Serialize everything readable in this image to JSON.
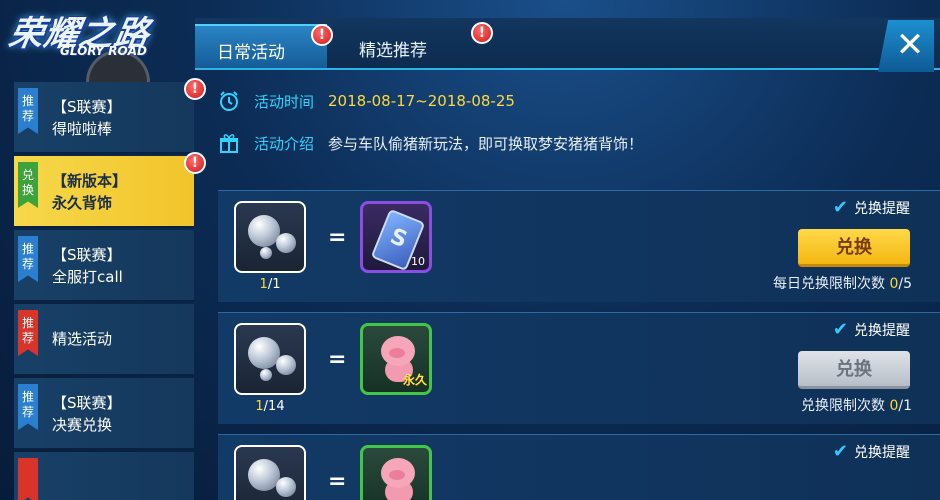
{
  "logo": {
    "title": "荣耀之路",
    "subtitle": "GLORY ROAD"
  },
  "tabs": [
    {
      "label": "日常活动",
      "active": true
    },
    {
      "label": "精选推荐",
      "active": false
    }
  ],
  "alert_symbol": "!",
  "close_symbol": "✕",
  "sidebar": {
    "items": [
      {
        "tag": "推荐",
        "tag_color": "#2a7fd0",
        "line1": "【S联赛】",
        "line2": "得啦啦棒",
        "alert": true,
        "active": false
      },
      {
        "tag": "兑换",
        "tag_color": "#3da33a",
        "line1": "【新版本】",
        "line2": "永久背饰",
        "alert": true,
        "active": true
      },
      {
        "tag": "推荐",
        "tag_color": "#2a7fd0",
        "line1": "【S联赛】",
        "line2": "全服打call",
        "alert": false,
        "active": false
      },
      {
        "tag": "推荐",
        "tag_color": "#d8342a",
        "line1": "精选活动",
        "line2": "",
        "alert": false,
        "active": false
      },
      {
        "tag": "推荐",
        "tag_color": "#2a7fd0",
        "line1": "【S联赛】",
        "line2": "决赛兑换",
        "alert": false,
        "active": false
      }
    ]
  },
  "info": {
    "time_label": "活动时间",
    "time_value": "2018-08-17~2018-08-25",
    "desc_label": "活动介绍",
    "desc_value": "参与车队偷猪新玩法，即可换取梦安猪猪背饰！"
  },
  "cards": [
    {
      "equals": "=",
      "count_current": "1",
      "count_total": "/1",
      "reward_badge": "10",
      "remind_label": "兑换提醒",
      "button_label": "兑换",
      "button_state": "enabled",
      "limit_label": "每日兑换限制次数",
      "limit_used": "0",
      "limit_total": "/5"
    },
    {
      "equals": "=",
      "count_current": "1",
      "count_total": "/14",
      "reward_badge": "永久",
      "remind_label": "兑换提醒",
      "button_label": "兑换",
      "button_state": "disabled",
      "limit_label": "兑换限制次数",
      "limit_used": "0",
      "limit_total": "/1"
    },
    {
      "equals": "=",
      "remind_label": "兑换提醒"
    }
  ],
  "colors": {
    "accent_cyan": "#2fd3ff",
    "highlight_yellow": "#ffd83c",
    "button_gold": "#f3b712",
    "button_grey": "#b8bfc8",
    "alert_red": "#d31919"
  }
}
